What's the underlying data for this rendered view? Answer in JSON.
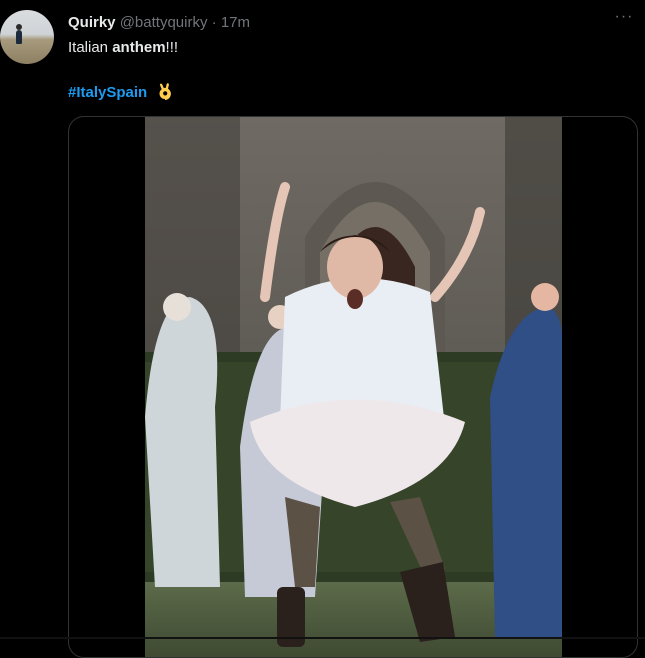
{
  "tweet": {
    "display_name": "Quirky",
    "handle": "@battyquirky",
    "separator": "·",
    "time": "17m",
    "more_label": "···",
    "text_before": "Italian ",
    "text_bold": "anthem",
    "text_after": "!!!",
    "hashtag": "#ItalySpain",
    "emoji_icon": "ok-hand-icon"
  },
  "colors": {
    "background": "#000000",
    "text": "#e7e9ea",
    "muted": "#71767b",
    "link": "#1d9bf0",
    "border": "#2f3336"
  }
}
